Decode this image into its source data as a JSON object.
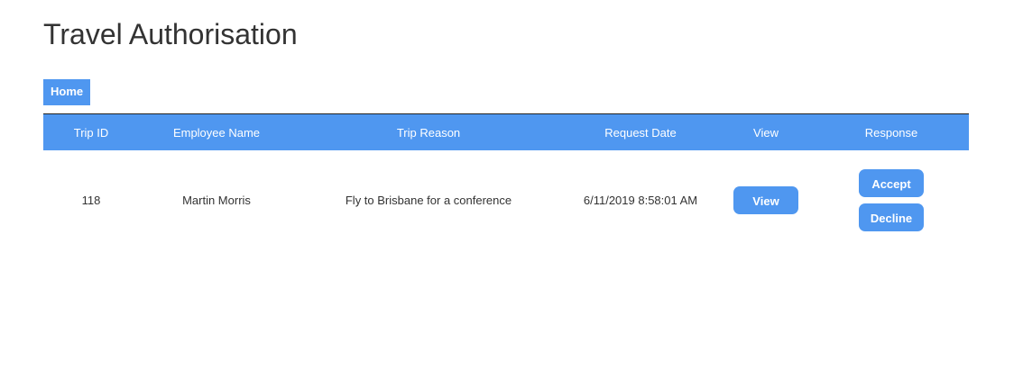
{
  "page": {
    "title": "Travel Authorisation"
  },
  "nav": {
    "home_label": "Home"
  },
  "table": {
    "headers": [
      "Trip ID",
      "Employee Name",
      "Trip Reason",
      "Request Date",
      "View",
      "Response"
    ],
    "rows": [
      {
        "trip_id": "118",
        "employee_name": "Martin Morris",
        "trip_reason": "Fly to Brisbane for a conference",
        "request_date": "6/11/2019 8:58:01 AM",
        "view_label": "View",
        "accept_label": "Accept",
        "decline_label": "Decline"
      }
    ]
  },
  "colors": {
    "accent": "#4f97f0",
    "text": "#333333",
    "header_text": "#ffffff"
  }
}
